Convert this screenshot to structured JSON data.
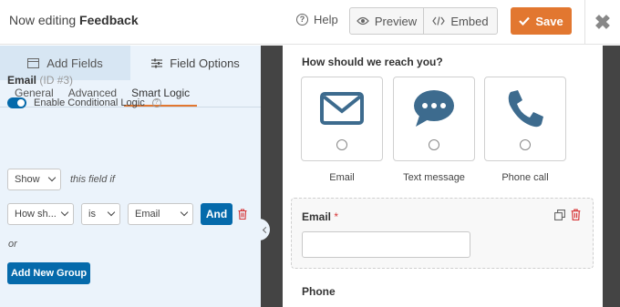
{
  "topbar": {
    "title_prefix": "Now editing",
    "form_name": "Feedback",
    "help_label": "Help",
    "preview_label": "Preview",
    "embed_label": "Embed",
    "save_label": "Save"
  },
  "panel": {
    "tabs": [
      {
        "label": "Add Fields",
        "icon": "list-icon",
        "active": false
      },
      {
        "label": "Field Options",
        "icon": "sliders-icon",
        "active": true
      }
    ],
    "subtabs": [
      {
        "label": "General",
        "active": false
      },
      {
        "label": "Advanced",
        "active": false
      },
      {
        "label": "Smart Logic",
        "active": true
      }
    ],
    "field_name": "Email",
    "field_id": "(ID #3)",
    "toggle_label": "Enable Conditional Logic",
    "toggle_on": true,
    "action_select": "Show",
    "this_field_if": "this field if",
    "rule": {
      "field": "How sh...",
      "operator": "is",
      "value": "Email",
      "and_label": "And"
    },
    "or_label": "or",
    "add_group_label": "Add New Group"
  },
  "preview": {
    "question": "How should we reach you?",
    "choices": [
      {
        "label": "Email",
        "icon": "envelope-icon"
      },
      {
        "label": "Text message",
        "icon": "chat-bubble-icon"
      },
      {
        "label": "Phone call",
        "icon": "phone-icon"
      }
    ],
    "email_label": "Email",
    "required_mark": "*",
    "phone_label": "Phone"
  },
  "colors": {
    "accent": "#e27730",
    "primary": "#056aab",
    "icon_fill": "#3d6b8e",
    "danger": "#d63638"
  }
}
